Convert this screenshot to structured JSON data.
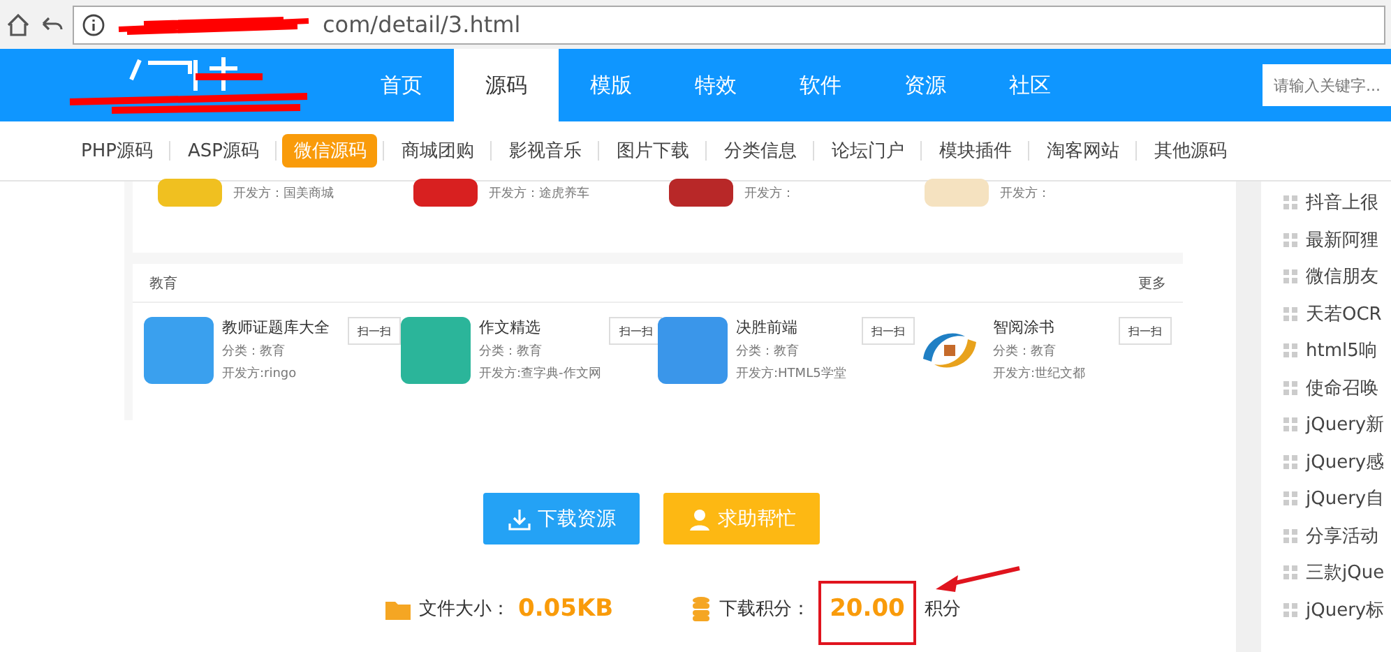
{
  "browser": {
    "url": "com/detail/3.html"
  },
  "nav": {
    "items": [
      {
        "label": "首页",
        "selected": false
      },
      {
        "label": "源码",
        "selected": true
      },
      {
        "label": "模版",
        "selected": false
      },
      {
        "label": "特效",
        "selected": false
      },
      {
        "label": "软件",
        "selected": false
      },
      {
        "label": "资源",
        "selected": false
      },
      {
        "label": "社区",
        "selected": false
      }
    ],
    "search": {
      "placeholder": "请输入关键字..."
    }
  },
  "subnav": [
    {
      "label": "PHP源码",
      "selected": false
    },
    {
      "label": "ASP源码",
      "selected": false
    },
    {
      "label": "微信源码",
      "selected": true
    },
    {
      "label": "商城团购",
      "selected": false
    },
    {
      "label": "影视音乐",
      "selected": false
    },
    {
      "label": "图片下载",
      "selected": false
    },
    {
      "label": "分类信息",
      "selected": false
    },
    {
      "label": "论坛门户",
      "selected": false
    },
    {
      "label": "模块插件",
      "selected": false
    },
    {
      "label": "淘客网站",
      "selected": false
    },
    {
      "label": "其他源码",
      "selected": false
    }
  ],
  "top_apps": [
    {
      "developer": "开发方：国美商城",
      "color": "#f0c020"
    },
    {
      "developer": "开发方：途虎养车",
      "color": "#d82020"
    },
    {
      "developer": "开发方：",
      "color": "#b82828"
    },
    {
      "developer": "开发方：",
      "color": "#f5e2c0"
    }
  ],
  "section": {
    "title": "教育",
    "more": "更多",
    "apps": [
      {
        "name": "教师证题库大全",
        "category": "分类：教育",
        "developer": "开发方:ringo",
        "scan": "扫一扫",
        "color": "#3aa0ee"
      },
      {
        "name": "作文精选",
        "category": "分类：教育",
        "developer": "开发方:查字典-作文网",
        "scan": "扫一扫",
        "color": "#2bb59a"
      },
      {
        "name": "决胜前端",
        "category": "分类：教育",
        "developer": "开发方:HTML5学堂",
        "scan": "扫一扫",
        "color": "#3a96ea"
      },
      {
        "name": "智阅涂书",
        "category": "分类：教育",
        "developer": "开发方:世纪文都",
        "scan": "扫一扫",
        "color": "#ffffff"
      }
    ]
  },
  "actions": [
    {
      "label": "下载资源",
      "kind": "download"
    },
    {
      "label": "求助帮忙",
      "kind": "help"
    }
  ],
  "info": {
    "size_label": "文件大小：",
    "size": "0.05KB",
    "points_label": "下载积分：",
    "points": "20.00",
    "points_unit": "积分"
  },
  "sidebar": [
    "抖音上很",
    "最新阿狸",
    "微信朋友",
    "天若OCR",
    "html5响",
    "使命召唤",
    "jQuery新",
    "jQuery感",
    "jQuery自",
    "分享活动",
    "三款jQue",
    "jQuery标"
  ]
}
